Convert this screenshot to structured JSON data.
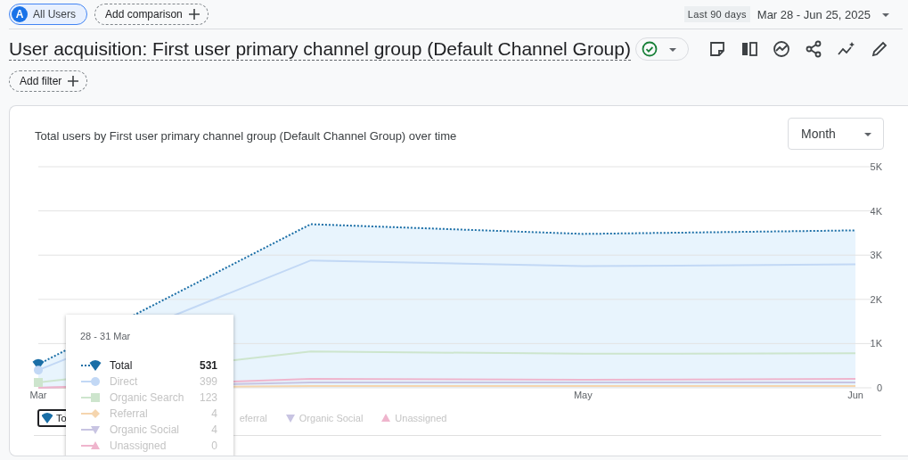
{
  "header": {
    "segment": {
      "avatar": "A",
      "label": "All Users"
    },
    "add_comparison": "Add comparison",
    "date_range": {
      "preset": "Last 90 days",
      "range": "Mar 28 - Jun 25, 2025"
    }
  },
  "report": {
    "title": "User acquisition: First user primary channel group (Default Channel Group)",
    "add_filter": "Add filter"
  },
  "card": {
    "title": "Total users by First user primary channel group (Default Channel Group) over time",
    "granularity": "Month",
    "chart_data": {
      "type": "line",
      "grid": true,
      "categories": [
        "Mar",
        null,
        "May",
        "Jun"
      ],
      "ylim": [
        0,
        5000
      ],
      "yticks": [
        {
          "value": 0,
          "label": "0"
        },
        {
          "value": 1000,
          "label": "1K"
        },
        {
          "value": 2000,
          "label": "2K"
        },
        {
          "value": 3000,
          "label": "3K"
        },
        {
          "value": 4000,
          "label": "4K"
        },
        {
          "value": 5000,
          "label": "5K"
        }
      ],
      "series": [
        {
          "name": "Total",
          "color": "#1a6ea6",
          "line_style": "dotted",
          "values": [
            530,
            3700,
            3480,
            3560
          ]
        },
        {
          "name": "Direct",
          "color": "#c2d8f5",
          "line_style": "solid",
          "values": [
            400,
            2880,
            2750,
            2790
          ]
        },
        {
          "name": "Organic Search",
          "color": "#cde5cd",
          "line_style": "solid",
          "values": [
            120,
            820,
            770,
            780
          ]
        },
        {
          "name": "Referral",
          "color": "#f5d5ae",
          "line_style": "solid",
          "values": [
            0,
            40,
            40,
            40
          ]
        },
        {
          "name": "Organic Social",
          "color": "#c8c4e2",
          "line_style": "solid",
          "values": [
            0,
            120,
            120,
            120
          ]
        },
        {
          "name": "Unassigned",
          "color": "#efb5cd",
          "line_style": "solid",
          "values": [
            0,
            200,
            180,
            200
          ]
        }
      ]
    },
    "legend": [
      {
        "label": "To",
        "kind": "pin",
        "color": "#1a6ea6",
        "selected": true
      },
      {
        "label": "eferral",
        "selected": false
      },
      {
        "label": "Organic Social",
        "kind": "triangle-down",
        "color": "#c8c4e2",
        "selected": false
      },
      {
        "label": "Unassigned",
        "kind": "triangle-up",
        "color": "#efb5cd",
        "selected": false
      }
    ],
    "tooltip": {
      "date": "28 - 31 Mar",
      "rows": [
        {
          "value": "531",
          "kind": "pin",
          "active": true
        },
        {
          "value": "399",
          "kind": "circle",
          "active": false
        },
        {
          "value": "123",
          "kind": "square",
          "active": false
        },
        {
          "value": "4",
          "kind": "diamond",
          "active": false
        },
        {
          "value": "4",
          "kind": "triangle-down",
          "active": false
        },
        {
          "value": "0",
          "kind": "triangle-up",
          "active": false
        }
      ]
    }
  }
}
